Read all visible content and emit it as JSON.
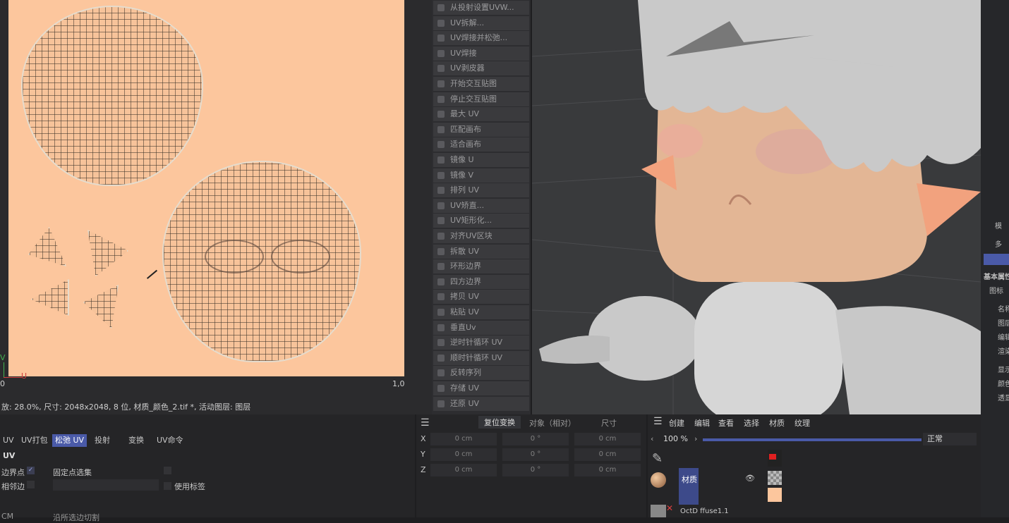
{
  "uv_editor": {
    "tick_origin": "0",
    "tick_max_x": "1,0",
    "axis_v": "V",
    "axis_u": "U",
    "status": "放: 28.0%, 尺寸: 2048x2048, 8 位, 材质_颜色_2.tif *, 活动图层: 图层"
  },
  "uv_commands": [
    "从投射设置UVW...",
    "UV拆解...",
    "UV焊接并松弛...",
    "UV焊接",
    "UV剥皮器",
    "开始交互贴图",
    "停止交互贴图",
    "最大 UV",
    "匹配画布",
    "适合画布",
    "镜像 U",
    "镜像 V",
    "排列 UV",
    "UV矫直...",
    "UV矩形化...",
    "对齐UV区块",
    "拆散 UV",
    "环形边界",
    "四方边界",
    "拷贝 UV",
    "粘贴 UV",
    "垂直Uv",
    "逆时针循环 UV",
    "顺时针循环 UV",
    "反转序列",
    "存储 UV",
    "还原 UV"
  ],
  "uv_tabs": {
    "tabs": [
      "UV",
      "UV打包",
      "松弛 UV",
      "投射",
      "变换",
      "UV命令"
    ],
    "active_index": 2,
    "section_title": "UV",
    "opt_border_points": "边界点",
    "opt_pin_selection": "固定点选集",
    "opt_neighbor_edges": "相邻边",
    "opt_use_tags": "使用标签",
    "cut_label": "沿所选边切割",
    "cm_label": "CM"
  },
  "coords": {
    "reset_button": "复位变换",
    "object_mode": "对象（相对）",
    "size_mode": "尺寸",
    "rows": [
      {
        "axis": "X",
        "pos": "0 cm",
        "rot": "0 °",
        "size": "0 cm"
      },
      {
        "axis": "Y",
        "pos": "0 cm",
        "rot": "0 °",
        "size": "0 cm"
      },
      {
        "axis": "Z",
        "pos": "0 cm",
        "rot": "0 °",
        "size": "0 cm"
      }
    ]
  },
  "materials": {
    "menu": [
      "创建",
      "编辑",
      "查看",
      "选择",
      "材质",
      "纹理"
    ],
    "zoom": "100 %",
    "blend_mode": "正常",
    "material_name": "材质",
    "second_material": "OctD ffuse1.1"
  },
  "right_panel": {
    "labels": [
      "模",
      "多",
      "基本属性",
      "图标",
      "名称",
      "图层",
      "编辑",
      "渲染",
      "显示",
      "颜色",
      "透显"
    ]
  },
  "colors": {
    "canvas_bg": "#fcc69d",
    "active_tab": "#4a5aa8",
    "panel_bg": "#252527"
  }
}
